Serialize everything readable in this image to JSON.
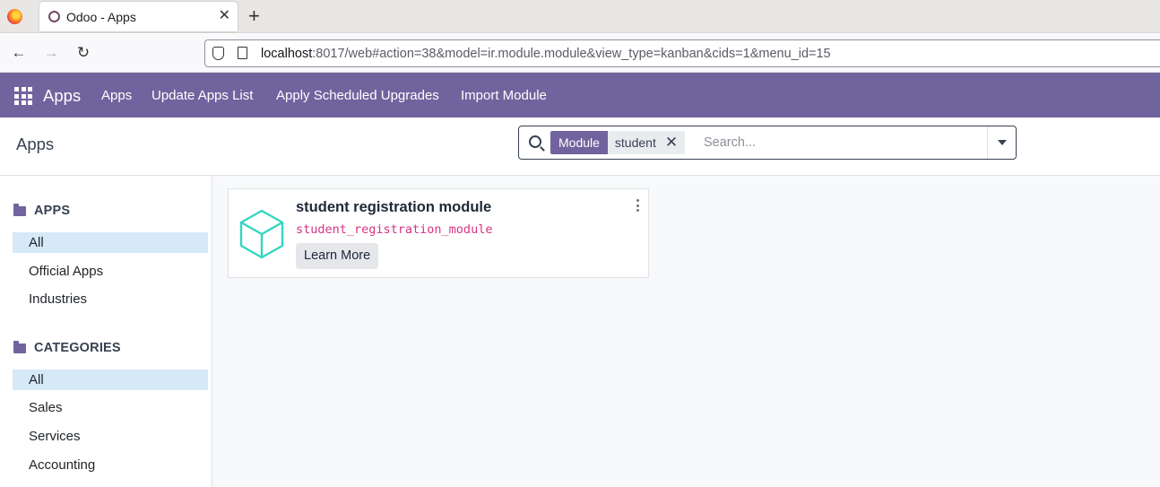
{
  "browser": {
    "tab_title": "Odoo - Apps",
    "tab_close": "✕",
    "new_tab": "+",
    "back": "←",
    "forward": "→",
    "reload": "↻",
    "url_host": "localhost",
    "url_rest": ":8017/web#action=38&model=ir.module.module&view_type=kanban&cids=1&menu_id=15"
  },
  "topbar": {
    "brand": "Apps",
    "menu": [
      "Apps",
      "Update Apps List",
      "Apply Scheduled Upgrades",
      "Import Module"
    ]
  },
  "control_panel": {
    "breadcrumb": "Apps",
    "facet_category": "Module",
    "facet_value": "student",
    "facet_remove": "✕",
    "search_placeholder": "Search..."
  },
  "sidepanel": {
    "apps_header": "APPS",
    "apps_items": [
      "All",
      "Official Apps",
      "Industries"
    ],
    "categories_header": "CATEGORIES",
    "categories_items": [
      "All",
      "Sales",
      "Services",
      "Accounting"
    ]
  },
  "kanban": {
    "card": {
      "title": "student registration module",
      "technical_name": "student_registration_module",
      "button_label": "Learn More"
    }
  },
  "colors": {
    "brand_purple": "#71639e",
    "active_item_bg": "#d6e9f7",
    "tech_name_pink": "#d63384",
    "module_icon_teal": "#35d6c0"
  }
}
